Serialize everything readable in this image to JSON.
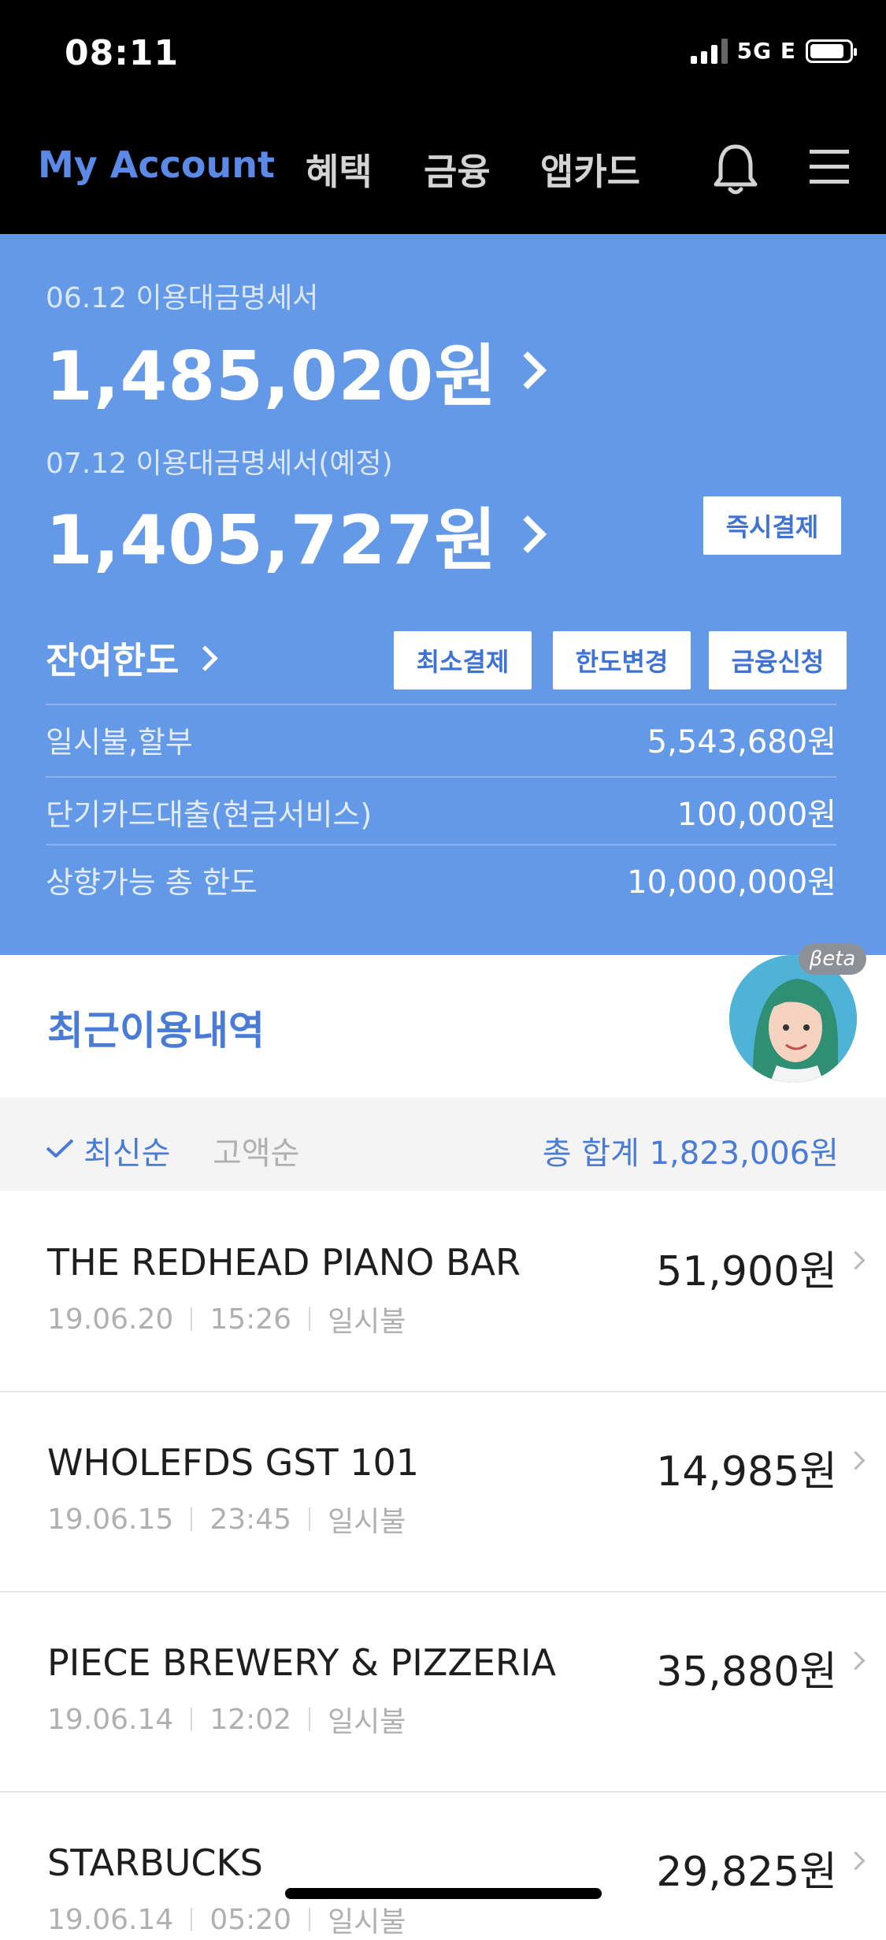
{
  "status": {
    "time": "08:11",
    "network": "5G E"
  },
  "nav": {
    "items": [
      {
        "label": "My Account",
        "active": true
      },
      {
        "label": "혜택"
      },
      {
        "label": "금융"
      },
      {
        "label": "앱카드"
      }
    ],
    "icons": [
      "bell-icon",
      "menu-icon"
    ]
  },
  "summary": {
    "current_label": "06.12 이용대금명세서",
    "current_amount": "1,485,020원",
    "next_label": "07.12 이용대금명세서(예정)",
    "next_amount": "1,405,727원",
    "pay_now_button": "즉시결제",
    "limit_title": "잔여한도",
    "buttons": [
      "최소결제",
      "한도변경",
      "금융신청"
    ],
    "rows": [
      {
        "label": "일시불,할부",
        "value": "5,543,680원"
      },
      {
        "label": "단기카드대출(현금서비스)",
        "value": "100,000원"
      },
      {
        "label": "상향가능 총 한도",
        "value": "10,000,000원"
      }
    ],
    "accent_color": "#6399e6"
  },
  "recent": {
    "title": "최근이용내역",
    "beta": "βeta",
    "sort_latest": "최신순",
    "sort_amount": "고액순",
    "total": "총 합계 1,823,006원"
  },
  "transactions": [
    {
      "name": "THE REDHEAD PIANO BAR",
      "date": "19.06.20",
      "time": "15:26",
      "type": "일시불",
      "amount": "51,900원"
    },
    {
      "name": "WHOLEFDS GST 101",
      "date": "19.06.15",
      "time": "23:45",
      "type": "일시불",
      "amount": "14,985원"
    },
    {
      "name": "PIECE BREWERY & PIZZERIA",
      "date": "19.06.14",
      "time": "12:02",
      "type": "일시불",
      "amount": "35,880원"
    },
    {
      "name": "STARBUCKS",
      "date": "19.06.14",
      "time": "05:20",
      "type": "일시불",
      "amount": "29,825원"
    }
  ]
}
